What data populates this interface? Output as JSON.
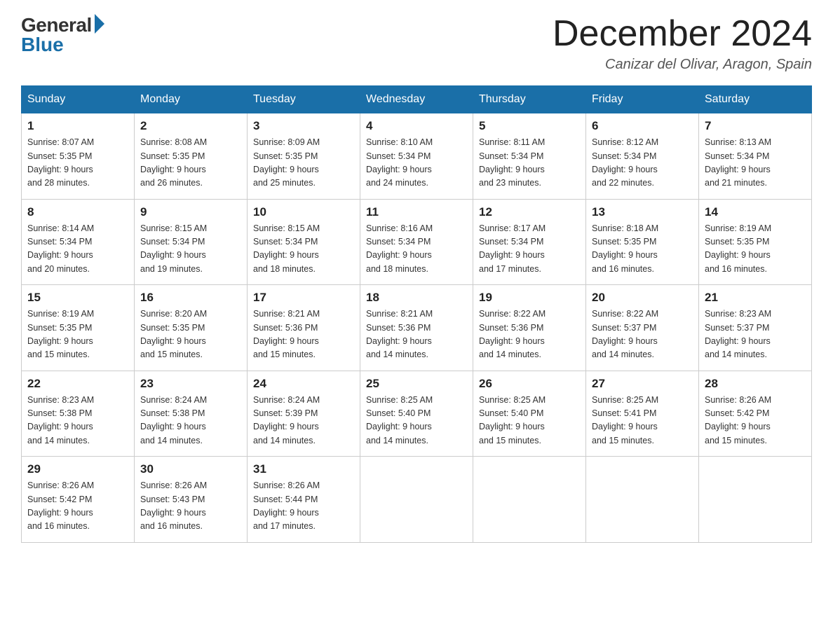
{
  "logo": {
    "general": "General",
    "blue": "Blue"
  },
  "title": "December 2024",
  "location": "Canizar del Olivar, Aragon, Spain",
  "days_of_week": [
    "Sunday",
    "Monday",
    "Tuesday",
    "Wednesday",
    "Thursday",
    "Friday",
    "Saturday"
  ],
  "weeks": [
    [
      {
        "day": "1",
        "sunrise": "8:07 AM",
        "sunset": "5:35 PM",
        "daylight": "9 hours and 28 minutes."
      },
      {
        "day": "2",
        "sunrise": "8:08 AM",
        "sunset": "5:35 PM",
        "daylight": "9 hours and 26 minutes."
      },
      {
        "day": "3",
        "sunrise": "8:09 AM",
        "sunset": "5:35 PM",
        "daylight": "9 hours and 25 minutes."
      },
      {
        "day": "4",
        "sunrise": "8:10 AM",
        "sunset": "5:34 PM",
        "daylight": "9 hours and 24 minutes."
      },
      {
        "day": "5",
        "sunrise": "8:11 AM",
        "sunset": "5:34 PM",
        "daylight": "9 hours and 23 minutes."
      },
      {
        "day": "6",
        "sunrise": "8:12 AM",
        "sunset": "5:34 PM",
        "daylight": "9 hours and 22 minutes."
      },
      {
        "day": "7",
        "sunrise": "8:13 AM",
        "sunset": "5:34 PM",
        "daylight": "9 hours and 21 minutes."
      }
    ],
    [
      {
        "day": "8",
        "sunrise": "8:14 AM",
        "sunset": "5:34 PM",
        "daylight": "9 hours and 20 minutes."
      },
      {
        "day": "9",
        "sunrise": "8:15 AM",
        "sunset": "5:34 PM",
        "daylight": "9 hours and 19 minutes."
      },
      {
        "day": "10",
        "sunrise": "8:15 AM",
        "sunset": "5:34 PM",
        "daylight": "9 hours and 18 minutes."
      },
      {
        "day": "11",
        "sunrise": "8:16 AM",
        "sunset": "5:34 PM",
        "daylight": "9 hours and 18 minutes."
      },
      {
        "day": "12",
        "sunrise": "8:17 AM",
        "sunset": "5:34 PM",
        "daylight": "9 hours and 17 minutes."
      },
      {
        "day": "13",
        "sunrise": "8:18 AM",
        "sunset": "5:35 PM",
        "daylight": "9 hours and 16 minutes."
      },
      {
        "day": "14",
        "sunrise": "8:19 AM",
        "sunset": "5:35 PM",
        "daylight": "9 hours and 16 minutes."
      }
    ],
    [
      {
        "day": "15",
        "sunrise": "8:19 AM",
        "sunset": "5:35 PM",
        "daylight": "9 hours and 15 minutes."
      },
      {
        "day": "16",
        "sunrise": "8:20 AM",
        "sunset": "5:35 PM",
        "daylight": "9 hours and 15 minutes."
      },
      {
        "day": "17",
        "sunrise": "8:21 AM",
        "sunset": "5:36 PM",
        "daylight": "9 hours and 15 minutes."
      },
      {
        "day": "18",
        "sunrise": "8:21 AM",
        "sunset": "5:36 PM",
        "daylight": "9 hours and 14 minutes."
      },
      {
        "day": "19",
        "sunrise": "8:22 AM",
        "sunset": "5:36 PM",
        "daylight": "9 hours and 14 minutes."
      },
      {
        "day": "20",
        "sunrise": "8:22 AM",
        "sunset": "5:37 PM",
        "daylight": "9 hours and 14 minutes."
      },
      {
        "day": "21",
        "sunrise": "8:23 AM",
        "sunset": "5:37 PM",
        "daylight": "9 hours and 14 minutes."
      }
    ],
    [
      {
        "day": "22",
        "sunrise": "8:23 AM",
        "sunset": "5:38 PM",
        "daylight": "9 hours and 14 minutes."
      },
      {
        "day": "23",
        "sunrise": "8:24 AM",
        "sunset": "5:38 PM",
        "daylight": "9 hours and 14 minutes."
      },
      {
        "day": "24",
        "sunrise": "8:24 AM",
        "sunset": "5:39 PM",
        "daylight": "9 hours and 14 minutes."
      },
      {
        "day": "25",
        "sunrise": "8:25 AM",
        "sunset": "5:40 PM",
        "daylight": "9 hours and 14 minutes."
      },
      {
        "day": "26",
        "sunrise": "8:25 AM",
        "sunset": "5:40 PM",
        "daylight": "9 hours and 15 minutes."
      },
      {
        "day": "27",
        "sunrise": "8:25 AM",
        "sunset": "5:41 PM",
        "daylight": "9 hours and 15 minutes."
      },
      {
        "day": "28",
        "sunrise": "8:26 AM",
        "sunset": "5:42 PM",
        "daylight": "9 hours and 15 minutes."
      }
    ],
    [
      {
        "day": "29",
        "sunrise": "8:26 AM",
        "sunset": "5:42 PM",
        "daylight": "9 hours and 16 minutes."
      },
      {
        "day": "30",
        "sunrise": "8:26 AM",
        "sunset": "5:43 PM",
        "daylight": "9 hours and 16 minutes."
      },
      {
        "day": "31",
        "sunrise": "8:26 AM",
        "sunset": "5:44 PM",
        "daylight": "9 hours and 17 minutes."
      },
      null,
      null,
      null,
      null
    ]
  ]
}
